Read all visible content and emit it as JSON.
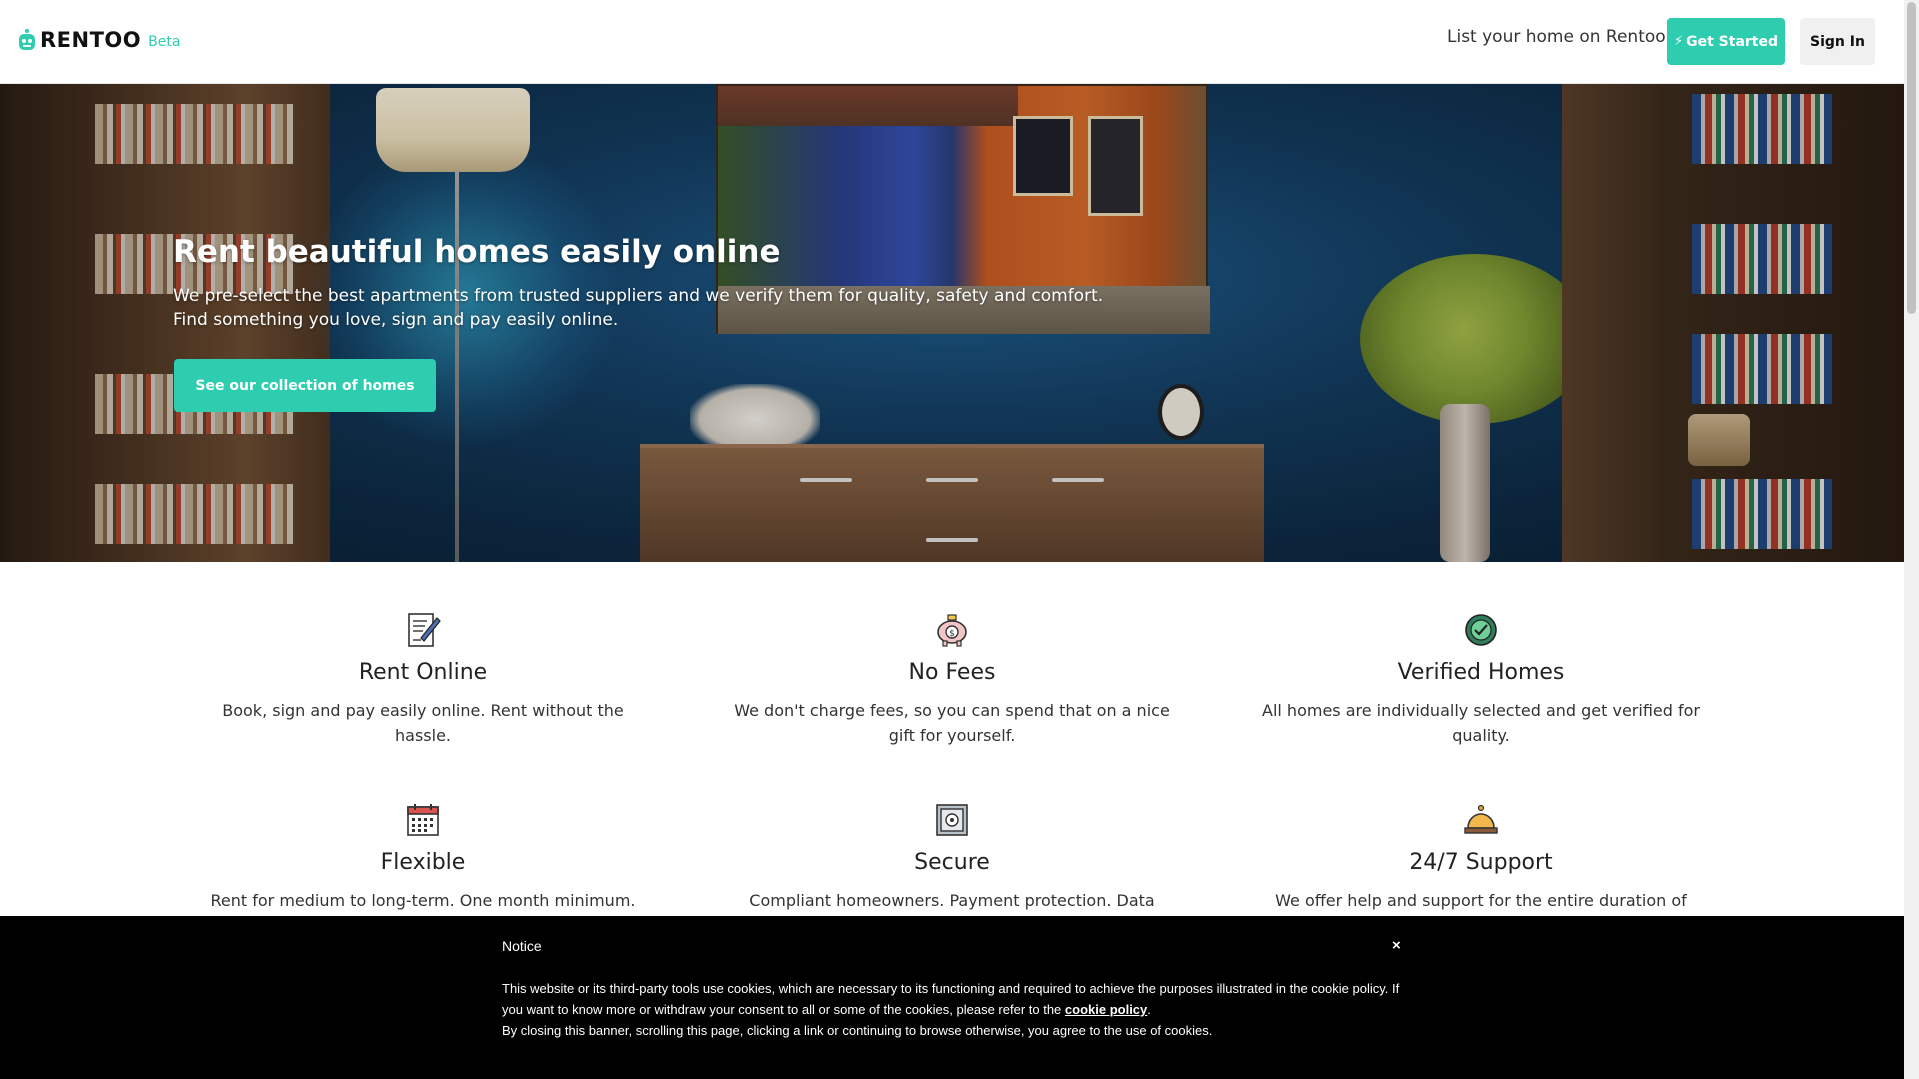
{
  "header": {
    "logo_text": "RENTOO",
    "logo_badge": "Beta",
    "list_home_link": "List your home on Rentoo",
    "get_started_label": "Get Started",
    "sign_in_label": "Sign In"
  },
  "hero": {
    "title": "Rent beautiful homes easily online",
    "subtitle_line1": "We pre-select the best apartments from trusted suppliers and we verify them for quality, safety and comfort.",
    "subtitle_line2": "Find something you love, sign and pay easily online.",
    "cta_label": "See our collection of homes"
  },
  "features": [
    {
      "icon": "contract-pen-icon",
      "title": "Rent Online",
      "description": "Book, sign and pay easily online. Rent without the hassle."
    },
    {
      "icon": "piggy-bank-icon",
      "title": "No Fees",
      "description": "We don't charge fees, so you can spend that on a nice gift for yourself."
    },
    {
      "icon": "verified-check-icon",
      "title": "Verified Homes",
      "description": "All homes are individually selected and get verified for quality."
    },
    {
      "icon": "calendar-icon",
      "title": "Flexible",
      "description": "Rent for medium to long-term. One month minimum."
    },
    {
      "icon": "safe-icon",
      "title": "Secure",
      "description": "Compliant homeowners. Payment protection. Data"
    },
    {
      "icon": "service-bell-icon",
      "title": "24/7 Support",
      "description": "We offer help and support for the entire duration of your"
    }
  ],
  "cookie_banner": {
    "title": "Notice",
    "close_label": "×",
    "text_part1": "This website or its third-party tools use cookies, which are necessary to its functioning and required to achieve the purposes illustrated in the cookie policy. If you want to know more or withdraw your consent to all or some of the cookies, please refer to the ",
    "link_label": "cookie policy",
    "text_part2": ".",
    "text_line3": "By closing this banner, scrolling this page, clicking a link or continuing to browse otherwise, you agree to the use of cookies."
  },
  "colors": {
    "accent": "#2ecdb0",
    "banner_bg": "#000000",
    "sign_in_bg": "#f0f0f0"
  }
}
